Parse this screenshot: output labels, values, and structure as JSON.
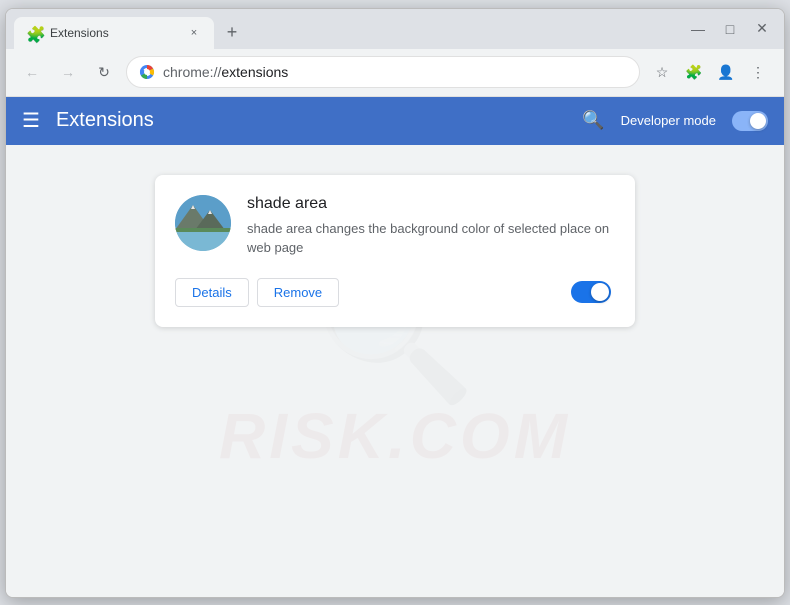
{
  "window": {
    "title": "Extensions",
    "tab_favicon": "puzzle-icon",
    "close_label": "×",
    "minimize_label": "—",
    "maximize_label": "□",
    "close_window_label": "✕"
  },
  "nav": {
    "back_label": "←",
    "forward_label": "→",
    "reload_label": "↻",
    "site_label": "Chrome",
    "address_scheme": "chrome://",
    "address_path": "extensions",
    "full_url": "chrome://extensions",
    "bookmark_icon": "star-icon",
    "extensions_icon": "puzzle-icon",
    "profile_icon": "person-icon",
    "menu_icon": "dots-icon",
    "profile_indicator_icon": "globe-icon"
  },
  "header": {
    "menu_icon": "hamburger-icon",
    "title": "Extensions",
    "search_icon": "search-icon",
    "dev_mode_label": "Developer mode",
    "toggle_state": "off"
  },
  "extension": {
    "name": "shade area",
    "description": "shade area changes the background color of selected place on web page",
    "details_btn": "Details",
    "remove_btn": "Remove",
    "enabled": true
  },
  "watermark": {
    "text": "RISK.COM"
  }
}
